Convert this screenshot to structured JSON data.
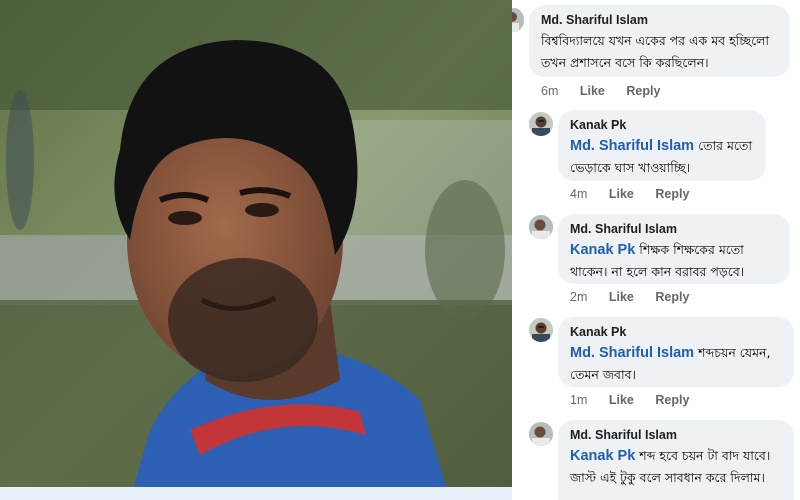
{
  "photo": {
    "subject": "portrait"
  },
  "comments": [
    {
      "author": "Md. Shariful Islam",
      "mention": "",
      "text": "বিশ্ববিদ্যালয়ে যখন একের পর এক মব হচ্ছিলো তখন প্রশাসনে বসে কি করছিলেন।",
      "time": "6m",
      "like": "Like",
      "reply": "Reply"
    },
    {
      "author": "Kanak Pk",
      "mention": "Md. Shariful Islam",
      "text": "তোর মতো ভেড়াকে ঘাস খাওয়াচ্ছি।",
      "time": "4m",
      "like": "Like",
      "reply": "Reply"
    },
    {
      "author": "Md. Shariful Islam",
      "mention": "Kanak Pk",
      "text": "শিক্ষক শিক্ষকের মতো থাকেন। না হলে কান বরাবর পড়বে।",
      "time": "2m",
      "like": "Like",
      "reply": "Reply"
    },
    {
      "author": "Kanak Pk",
      "mention": "Md. Shariful Islam",
      "text": "শব্দচয়ন যেমন, তেমন জবাব।",
      "time": "1m",
      "like": "Like",
      "reply": "Reply"
    },
    {
      "author": "Md. Shariful Islam",
      "mention": "Kanak Pk",
      "text": "শব্দ হবে চয়ন টা বাদ যাবে। জাস্ট এই টুকু বলে সাবধান করে দিলাম।",
      "time": "",
      "like": "",
      "reply": ""
    }
  ]
}
